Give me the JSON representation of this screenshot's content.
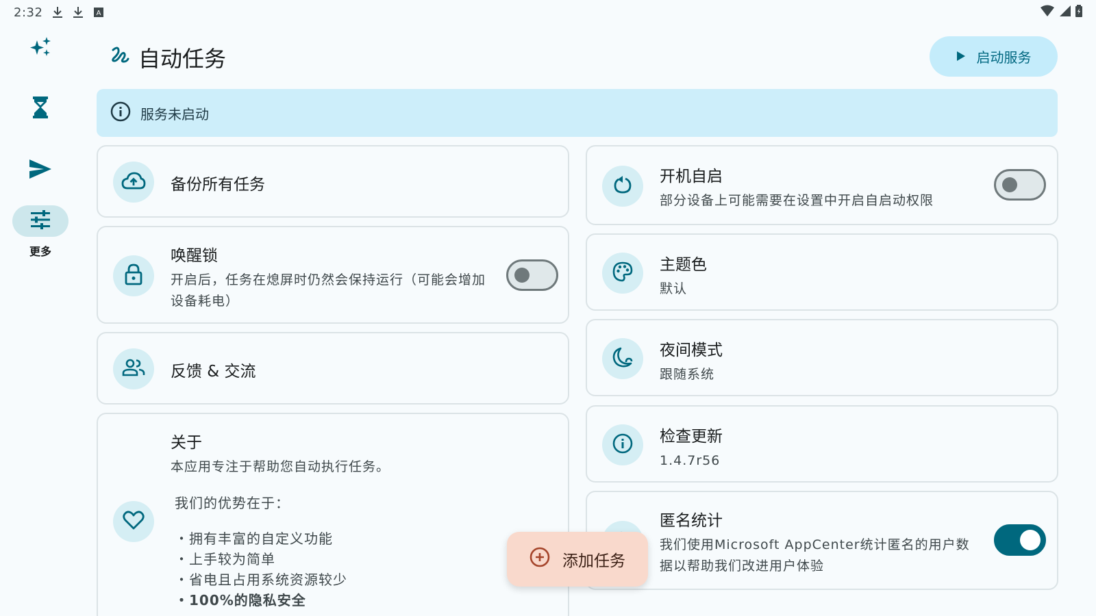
{
  "status_bar": {
    "time": "2:32",
    "icons": [
      "download-icon",
      "download-icon",
      "keyboard-icon"
    ],
    "right_icons": [
      "wifi-icon",
      "signal-icon",
      "battery-icon"
    ]
  },
  "rail": {
    "items": [
      {
        "icon": "sparkles-icon",
        "label": ""
      },
      {
        "icon": "hourglass-icon",
        "label": ""
      },
      {
        "icon": "send-icon",
        "label": ""
      },
      {
        "icon": "tune-icon",
        "label": "更多",
        "active": true
      }
    ]
  },
  "header": {
    "title": "自动任务",
    "start_button": "启动服务"
  },
  "banner": {
    "text": "服务未启动"
  },
  "left_cards": {
    "backup": {
      "title": "备份所有任务"
    },
    "wakelock": {
      "title": "唤醒锁",
      "subtitle": "开启后，任务在熄屏时仍然会保持运行（可能会增加设备耗电）",
      "switch_on": false
    },
    "feedback": {
      "title": "反馈 & 交流"
    },
    "about": {
      "title": "关于",
      "subtitle": "本应用专注于帮助您自动执行任务。",
      "lead": "我们的优势在于：",
      "bullets": [
        "・拥有丰富的自定义功能",
        "・上手较为简单",
        "・省电且占用系统资源较少",
        "・100%的隐私安全"
      ]
    }
  },
  "right_cards": {
    "autostart": {
      "title": "开机自启",
      "subtitle": "部分设备上可能需要在设置中开启自启动权限",
      "switch_on": false
    },
    "theme": {
      "title": "主题色",
      "subtitle": "默认"
    },
    "night": {
      "title": "夜间模式",
      "subtitle": "跟随系统"
    },
    "update": {
      "title": "检查更新",
      "subtitle": "1.4.7r56"
    },
    "stats": {
      "title": "匿名统计",
      "subtitle": "我们使用Microsoft AppCenter统计匿名的用户数据以帮助我们改进用户体验",
      "switch_on": true
    }
  },
  "fab": {
    "label": "添加任务"
  },
  "colors": {
    "accent": "#00687e",
    "banner_bg": "#cdeefa",
    "fab_bg": "#f9d9cc",
    "icon_bg": "#d5eef4"
  }
}
